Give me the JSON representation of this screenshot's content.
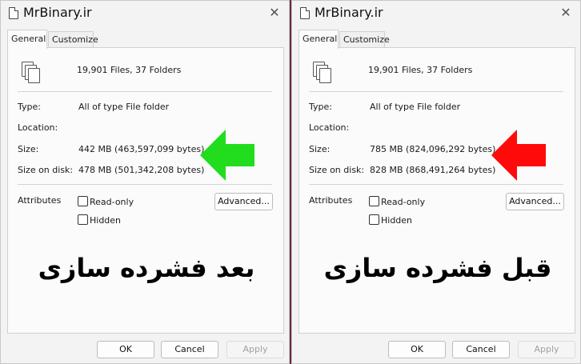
{
  "dialogs": [
    {
      "title": "MrBinary.ir",
      "tabs": [
        "General",
        "Customize"
      ],
      "summary": "19,901 Files, 37 Folders",
      "type_label": "Type:",
      "type_value": "All of type File folder",
      "location_label": "Location:",
      "size_label": "Size:",
      "size_value": "442 MB (463,597,099 bytes)",
      "size_on_disk_label": "Size on disk:",
      "size_on_disk_value": "478 MB (501,342,208 bytes)",
      "attributes_label": "Attributes",
      "readonly_label": "Read-only",
      "hidden_label": "Hidden",
      "advanced_label": "Advanced...",
      "caption": "بعد فشرده سازی",
      "arrow_color": "#22dd1e",
      "ok_label": "OK",
      "cancel_label": "Cancel",
      "apply_label": "Apply"
    },
    {
      "title": "MrBinary.ir",
      "tabs": [
        "General",
        "Customize"
      ],
      "summary": "19,901 Files, 37 Folders",
      "type_label": "Type:",
      "type_value": "All of type File folder",
      "location_label": "Location:",
      "size_label": "Size:",
      "size_value": "785 MB (824,096,292 bytes)",
      "size_on_disk_label": "Size on disk:",
      "size_on_disk_value": "828 MB (868,491,264 bytes)",
      "attributes_label": "Attributes",
      "readonly_label": "Read-only",
      "hidden_label": "Hidden",
      "advanced_label": "Advanced...",
      "caption": "قبل فشرده سازی",
      "arrow_color": "#ff0a0a",
      "ok_label": "OK",
      "cancel_label": "Cancel",
      "apply_label": "Apply"
    }
  ],
  "icons": {
    "close": "close-icon",
    "folder": "files-icon",
    "arrow_left": "arrow-left-icon"
  }
}
